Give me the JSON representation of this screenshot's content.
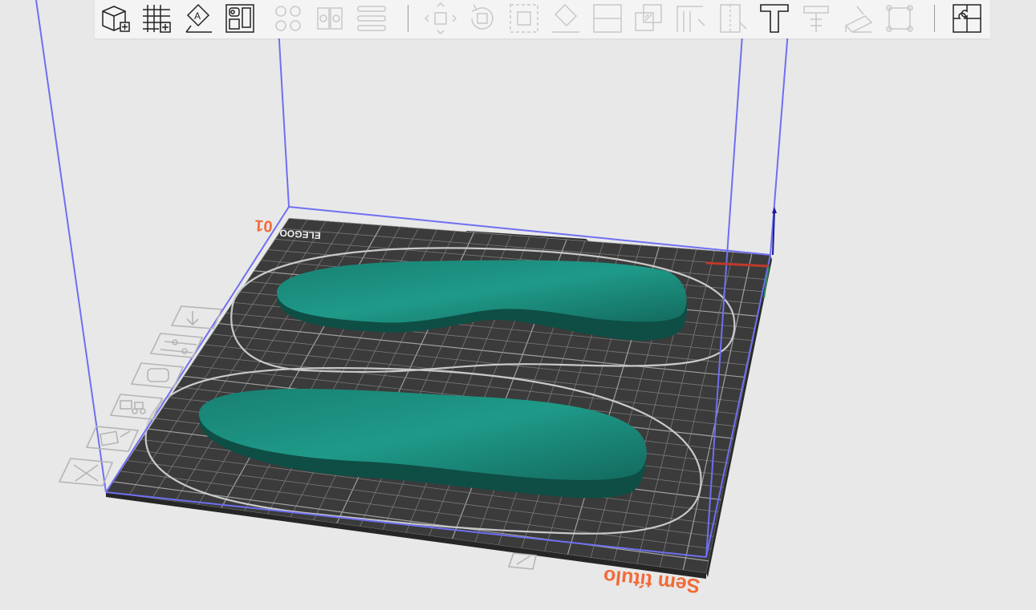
{
  "plate": {
    "name": "Sem título",
    "number": "01",
    "brand": "ELEGOO"
  },
  "colors": {
    "background": "#e8e8e8",
    "plate": "#3c3c3c",
    "grid": "#8c8c8c",
    "model": "#1d8a7b",
    "model_side": "#0f4f46",
    "volume": "#6f6ff2",
    "accent": "#f26b3a"
  },
  "toolbar": {
    "add_icon": "add-cube-icon",
    "add_plate_icon": "add-plate-icon",
    "auto_orient_icon": "auto-orient-icon",
    "arrange_icon": "arrange-icon",
    "split_objects_icon": "split-objects-icon",
    "split_parts_icon": "split-parts-icon",
    "layers_icon": "layers-icon",
    "move_icon": "move-icon",
    "rotate_icon": "rotate-icon",
    "scale_icon": "scale-icon",
    "lay_on_face_icon": "lay-on-face-icon",
    "cut_icon": "cut-icon",
    "mesh_boolean_icon": "mesh-boolean-icon",
    "support_paint_icon": "support-paint-icon",
    "seam_paint_icon": "seam-paint-icon",
    "text_icon": "text-icon",
    "measure_icon": "measure-icon",
    "assembly_icon": "assembly-icon",
    "emboss_icon": "emboss-icon",
    "variable_layer_icon": "variable-layer-icon"
  },
  "plate_tools": [
    "delete-plate-icon",
    "arrange-plate-icon",
    "lock-plate-icon",
    "plate-settings-icon",
    "orient-plate-icon",
    "move-plate-icon"
  ]
}
